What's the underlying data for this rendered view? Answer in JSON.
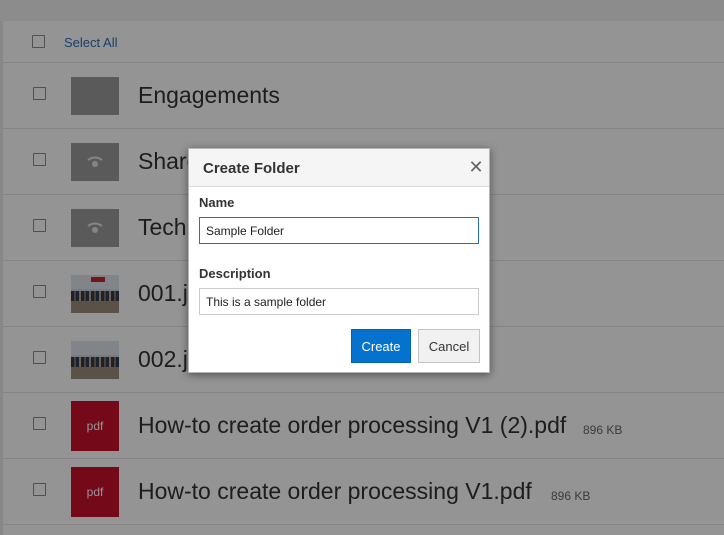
{
  "toolbar": {
    "select_all_label": "Select All"
  },
  "items": [
    {
      "name": "Engagements",
      "type": "folder",
      "size": ""
    },
    {
      "name": "Shared",
      "type": "shared-folder",
      "size": ""
    },
    {
      "name": "Technology",
      "type": "shared-folder",
      "size": ""
    },
    {
      "name": "001.jpg",
      "type": "image",
      "size": ""
    },
    {
      "name": "002.jpg",
      "type": "image",
      "size": ""
    },
    {
      "name": "How-to create order processing V1 (2).pdf",
      "type": "pdf",
      "thumb_label": "pdf",
      "size": "896 KB"
    },
    {
      "name": "How-to create order processing V1.pdf",
      "type": "pdf",
      "thumb_label": "pdf",
      "size": "896 KB"
    }
  ],
  "dialog": {
    "title": "Create Folder",
    "close_icon": "close-icon",
    "name_label": "Name",
    "name_value": "Sample Folder",
    "description_label": "Description",
    "description_value": "This is a sample folder",
    "create_label": "Create",
    "cancel_label": "Cancel"
  },
  "colors": {
    "primary_button": "#0572ce",
    "pdf_thumb": "#c8102e",
    "link": "#2a6ebb",
    "folder_thumb": "#9b9b9b"
  }
}
